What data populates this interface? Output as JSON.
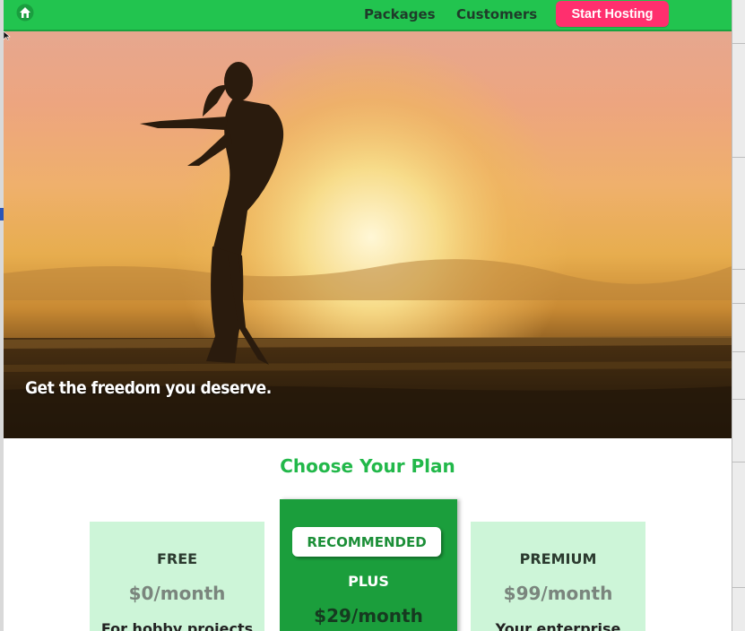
{
  "nav": {
    "logo_icon": "house-leaf-icon",
    "links": [
      {
        "label": "Packages"
      },
      {
        "label": "Customers"
      }
    ],
    "cta_label": "Start Hosting"
  },
  "hero": {
    "headline": "Get the freedom you deserve."
  },
  "plans": {
    "title": "Choose Your Plan",
    "cards": [
      {
        "name": "FREE",
        "price": "$0/month",
        "desc": "For hobby projects"
      },
      {
        "badge": "RECOMMENDED",
        "name": "PLUS",
        "price": "$29/month"
      },
      {
        "name": "PREMIUM",
        "price": "$99/month",
        "desc": "Your enterprise"
      }
    ]
  },
  "colors": {
    "nav_green": "#22c44f",
    "cta_pink": "#ff2f6e",
    "plan_light": "#cdf5d8",
    "plan_dark": "#1b9e3c"
  }
}
